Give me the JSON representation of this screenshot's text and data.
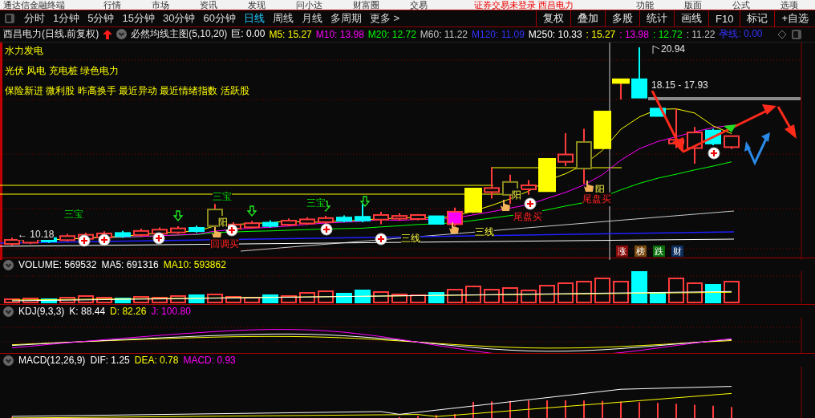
{
  "title_bar": {
    "app_title": "通达信金融终端",
    "menus": [
      "行情",
      "市场",
      "资讯",
      "发现",
      "问小达",
      "财富圈",
      "交易"
    ],
    "notice": "证券交易未登录  西昌电力",
    "menus_right": [
      "功能",
      "版面",
      "公式",
      "选项"
    ]
  },
  "period_tabs": [
    {
      "label": "分时",
      "selected": false
    },
    {
      "label": "1分钟",
      "selected": false
    },
    {
      "label": "5分钟",
      "selected": false
    },
    {
      "label": "15分钟",
      "selected": false
    },
    {
      "label": "30分钟",
      "selected": false
    },
    {
      "label": "60分钟",
      "selected": false
    },
    {
      "label": "日线",
      "selected": true
    },
    {
      "label": "周线",
      "selected": false
    },
    {
      "label": "月线",
      "selected": false
    },
    {
      "label": "多周期",
      "selected": false
    },
    {
      "label": "更多 >",
      "selected": false
    }
  ],
  "toolbar_buttons": [
    "复权",
    "叠加",
    "多股",
    "统计",
    "画线",
    "F10",
    "标记",
    "+自选"
  ],
  "quote_header": {
    "security": "西昌电力(日线.前复权)",
    "indicator": "必然均线主图(5,10,20)",
    "values": [
      {
        "label": "巨: 0.00",
        "color": "#ffffff"
      },
      {
        "label": "M5: 15.27",
        "color": "#ffff00"
      },
      {
        "label": "M10: 13.98",
        "color": "#ff00ff"
      },
      {
        "label": "M20: 12.72",
        "color": "#00ff00"
      },
      {
        "label": "M60: 11.22",
        "color": "#c8c8c8"
      },
      {
        "label": "M120: 11.09",
        "color": "#3333ff"
      },
      {
        "label": "M250: 10.33",
        "color": "#ffffff"
      },
      {
        "label": ": 15.27",
        "color": "#ffff00"
      },
      {
        "label": ": 13.98",
        "color": "#ff00ff"
      },
      {
        "label": ": 12.72",
        "color": "#00ff00"
      },
      {
        "label": ": 11.22",
        "color": "#c8c8c8"
      },
      {
        "label": "孕线: 0.00",
        "color": "#3333ff"
      }
    ]
  },
  "concept_tags": [
    "水力发电",
    "光伏 风电 充电桩 绿色电力",
    "保险新进 微利股 昨高换手 最近异动 最近情绪指数 活跃股"
  ],
  "price_labels": {
    "high": "20.94",
    "range": "18.15 - 17.93",
    "low": "← 10.18"
  },
  "signals": [
    {
      "kind": "pattern",
      "text": "三宝"
    },
    {
      "kind": "pattern",
      "text": "三宝"
    },
    {
      "kind": "pattern",
      "text": "三宝"
    },
    {
      "kind": "yang",
      "text": "阳"
    },
    {
      "kind": "buy",
      "text": "回调买"
    },
    {
      "kind": "line",
      "text": "三线"
    },
    {
      "kind": "line",
      "text": "三线"
    },
    {
      "kind": "yang",
      "text": "阳"
    },
    {
      "kind": "buy",
      "text": "尾盘买"
    },
    {
      "kind": "yang",
      "text": "阳"
    },
    {
      "kind": "buy",
      "text": "尾盘买"
    }
  ],
  "badges": [
    {
      "text": "涨",
      "color": "#8b0a0a"
    },
    {
      "text": "榜",
      "color": "#7a4a10"
    },
    {
      "text": "跌",
      "color": "#0a6e0a"
    },
    {
      "text": "财",
      "color": "#0d2f5e"
    }
  ],
  "volume_panel": {
    "values": [
      {
        "label": "VOLUME: 569532",
        "color": "#ffffff"
      },
      {
        "label": "MA5: 691316",
        "color": "#ffffff"
      },
      {
        "label": "MA10: 593862",
        "color": "#ffff00"
      }
    ]
  },
  "kdj_panel": {
    "values": [
      {
        "label": "KDJ(9,3,3)",
        "color": "#ffffff"
      },
      {
        "label": "K: 88.44",
        "color": "#ffffff"
      },
      {
        "label": "D: 82.26",
        "color": "#ffff00"
      },
      {
        "label": "J: 100.80",
        "color": "#ff00ff"
      }
    ]
  },
  "macd_panel": {
    "values": [
      {
        "label": "MACD(12,26,9)",
        "color": "#ffffff"
      },
      {
        "label": "DIF: 1.25",
        "color": "#ffffff"
      },
      {
        "label": "DEA: 0.78",
        "color": "#ffff00"
      },
      {
        "label": "MACD: 0.93",
        "color": "#ff00ff"
      }
    ]
  }
}
